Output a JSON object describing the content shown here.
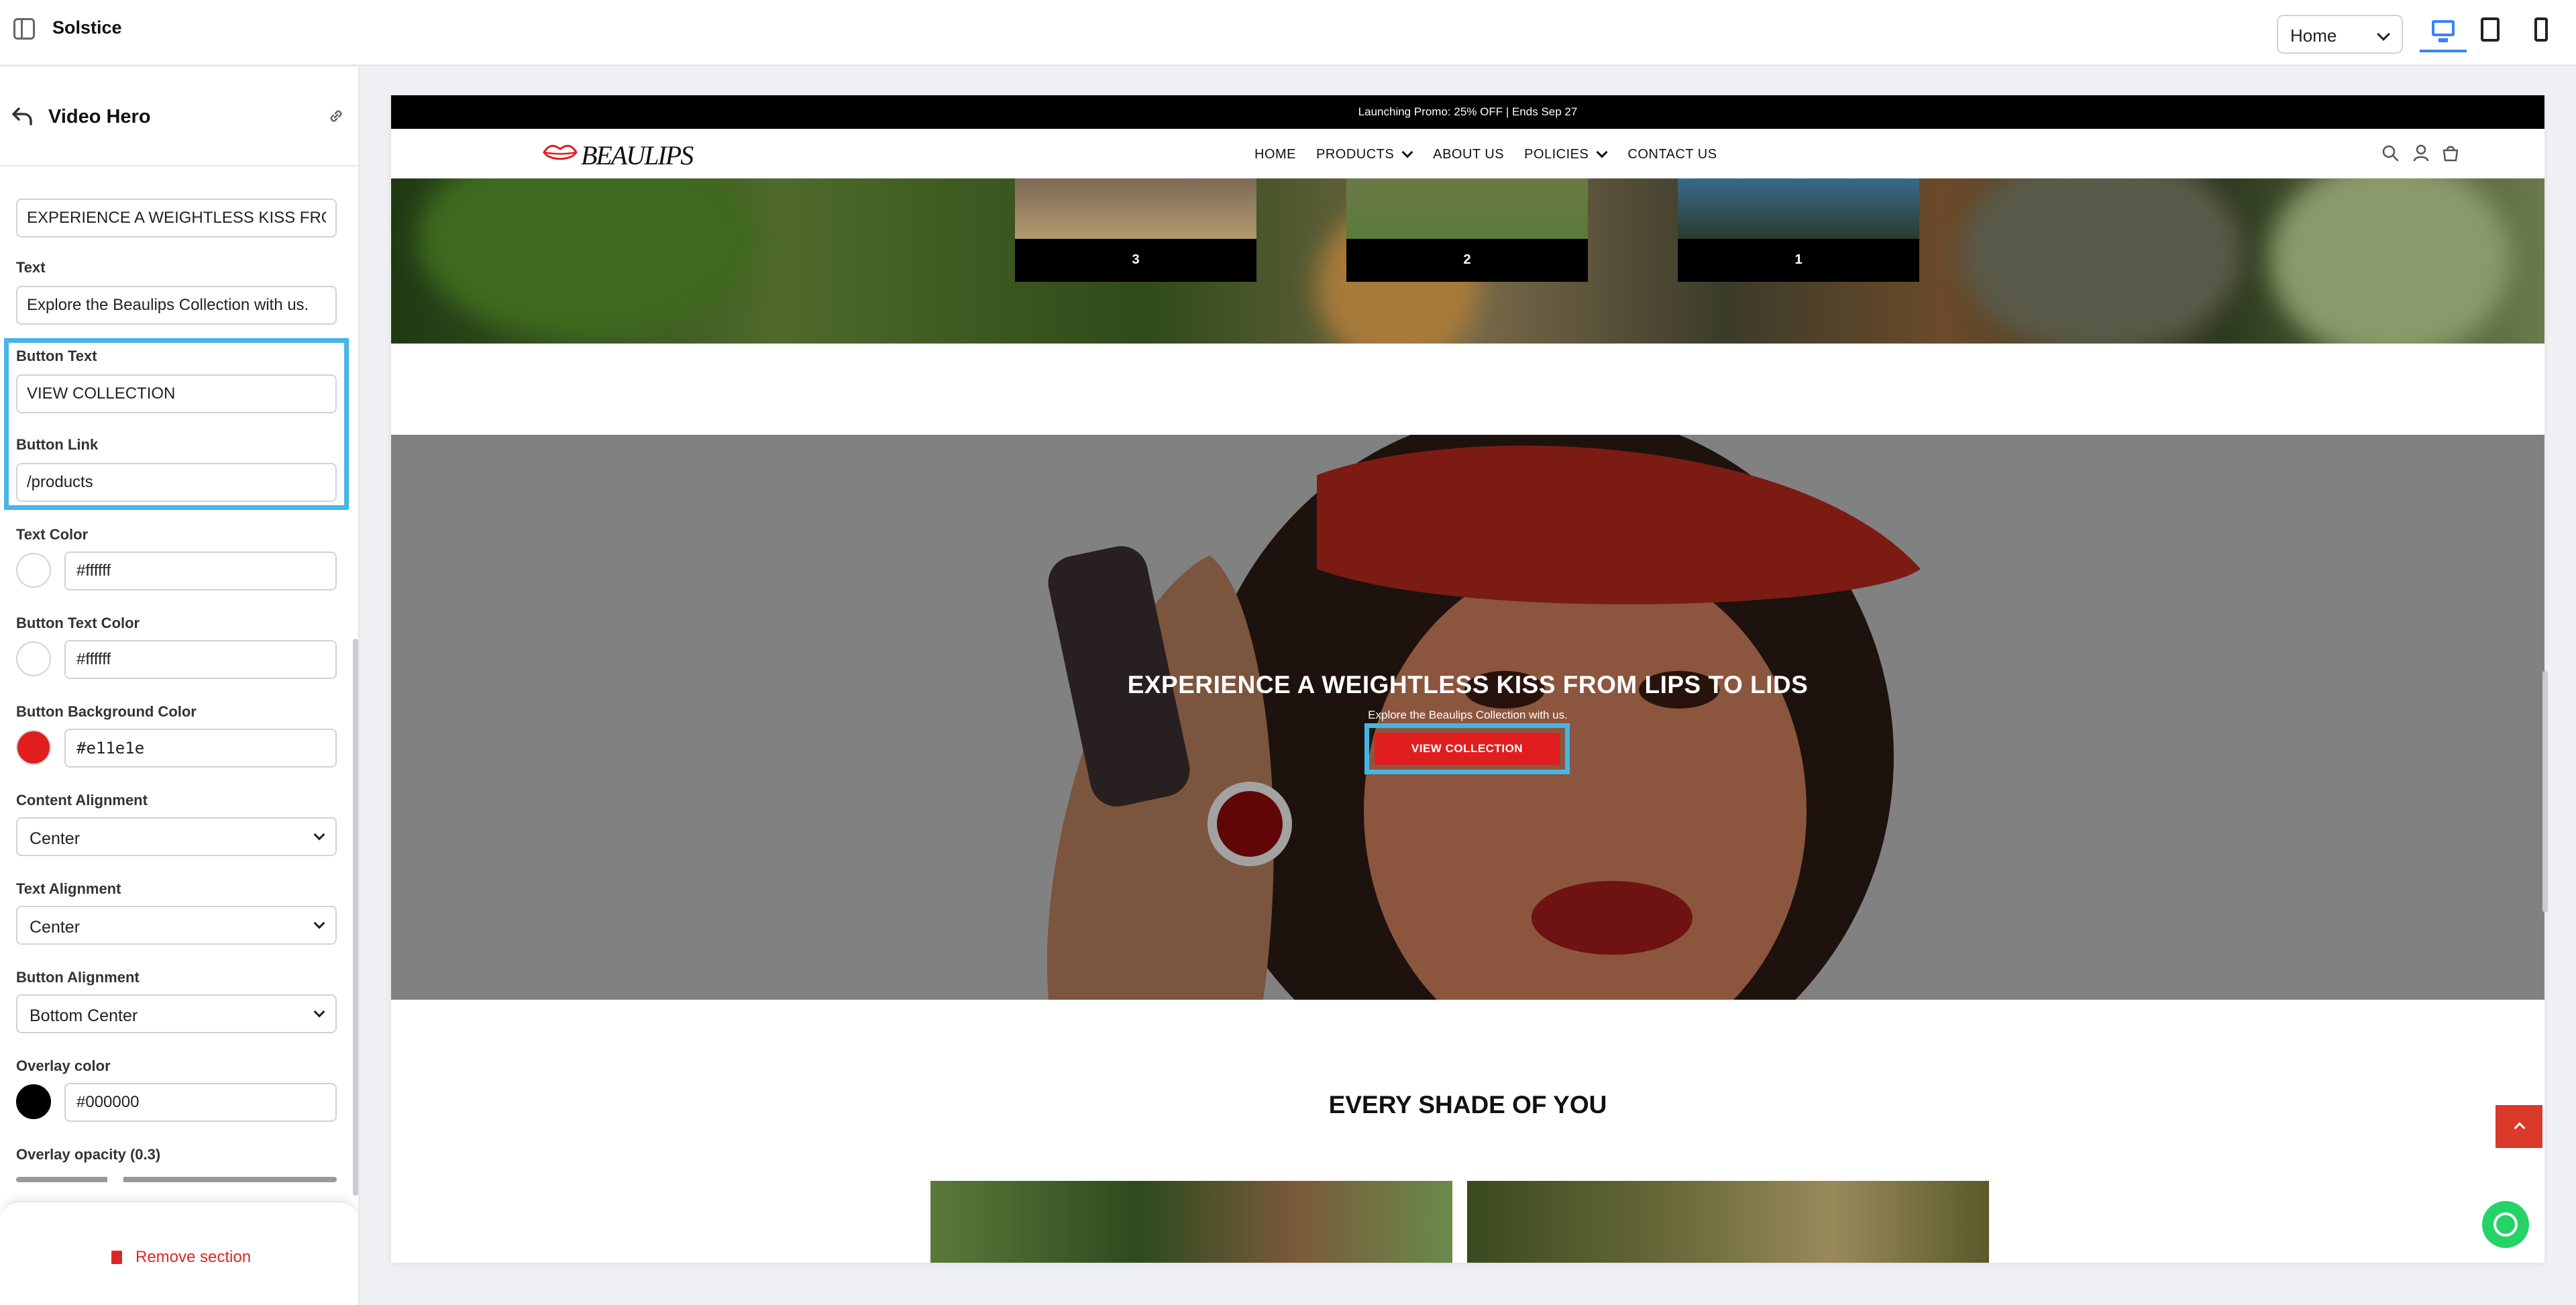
{
  "app": {
    "name": "Solstice"
  },
  "toolbar": {
    "page_select": "Home",
    "devices": [
      "desktop",
      "tablet",
      "mobile"
    ],
    "active_device": "desktop"
  },
  "sidebar": {
    "title": "Video Hero",
    "heading_value": "EXPERIENCE A WEIGHTLESS KISS FROM LIPS TO LIDS",
    "text": {
      "label": "Text",
      "value": "Explore the Beaulips Collection with us."
    },
    "button_text": {
      "label": "Button Text",
      "value": "VIEW COLLECTION"
    },
    "button_link": {
      "label": "Button Link",
      "value": "/products"
    },
    "text_color": {
      "label": "Text Color",
      "value": "#ffffff",
      "swatch": "#ffffff"
    },
    "button_text_color": {
      "label": "Button Text Color",
      "value": "#ffffff",
      "swatch": "#ffffff"
    },
    "button_bg_color": {
      "label": "Button Background Color",
      "value": "#e11e1e",
      "swatch": "#e11e1e"
    },
    "content_alignment": {
      "label": "Content Alignment",
      "value": "Center"
    },
    "text_alignment": {
      "label": "Text Alignment",
      "value": "Center"
    },
    "button_alignment": {
      "label": "Button Alignment",
      "value": "Bottom Center"
    },
    "overlay_color": {
      "label": "Overlay color",
      "value": "#000000",
      "swatch": "#000000"
    },
    "overlay_opacity": {
      "label": "Overlay opacity (0.3)",
      "value": 0.3
    },
    "remove_label": "Remove section"
  },
  "preview": {
    "promo": "Launching Promo: 25% OFF | Ends Sep 27",
    "logo": "BEAULIPS",
    "nav": [
      "HOME",
      "PRODUCTS",
      "ABOUT US",
      "POLICIES",
      "CONTACT US"
    ],
    "cards": [
      "3",
      "2",
      "1"
    ],
    "hero": {
      "heading": "EXPERIENCE A WEIGHTLESS KISS FROM LIPS TO LIDS",
      "sub": "Explore the Beaulips Collection with us.",
      "button": "VIEW COLLECTION"
    },
    "section_title": "EVERY SHADE OF YOU"
  },
  "colors": {
    "accent": "#3b82f6",
    "highlight": "#45b6e8",
    "danger": "#dc2626",
    "button_bg": "#e11e1e",
    "whatsapp": "#25d366"
  }
}
